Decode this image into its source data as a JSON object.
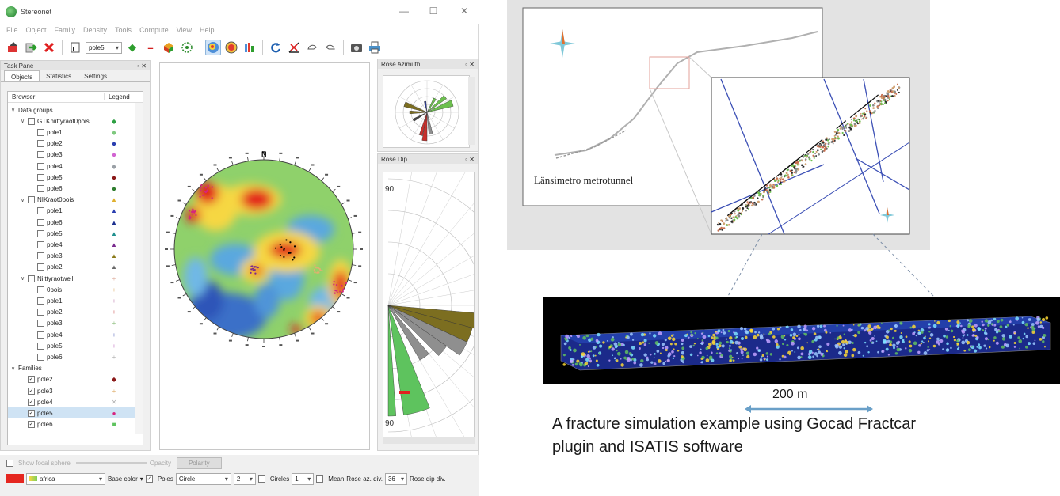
{
  "app": {
    "title": "Stereonet",
    "win_minimize": "—",
    "win_maximize": "☐",
    "win_close": "✕"
  },
  "menu": [
    "File",
    "Object",
    "Family",
    "Density",
    "Tools",
    "Compute",
    "View",
    "Help"
  ],
  "toolbar": {
    "selection": "pole5"
  },
  "task_pane": {
    "title": "Task Pane",
    "tabs": [
      "Objects",
      "Statistics",
      "Settings"
    ],
    "col_browser": "Browser",
    "col_legend": "Legend",
    "rows": [
      {
        "label": "Data groups",
        "level": 0,
        "twisty": "∨",
        "checkbox": false
      },
      {
        "label": "GTKniittyraot0pois",
        "level": 1,
        "twisty": "∨",
        "checkbox": true,
        "checked": false,
        "legend": "◆",
        "color": "#2ea043"
      },
      {
        "label": "pole1",
        "level": 2,
        "checkbox": true,
        "checked": false,
        "legend": "◆",
        "color": "#7fc97f"
      },
      {
        "label": "pole2",
        "level": 2,
        "checkbox": true,
        "checked": false,
        "legend": "◆",
        "color": "#2b3fb0"
      },
      {
        "label": "pole3",
        "level": 2,
        "checkbox": true,
        "checked": false,
        "legend": "◆",
        "color": "#d264d2"
      },
      {
        "label": "pole4",
        "level": 2,
        "checkbox": true,
        "checked": false,
        "legend": "◆",
        "color": "#9aa0a6"
      },
      {
        "label": "pole5",
        "level": 2,
        "checkbox": true,
        "checked": false,
        "legend": "◆",
        "color": "#8b1a1a"
      },
      {
        "label": "pole6",
        "level": 2,
        "checkbox": true,
        "checked": false,
        "legend": "◆",
        "color": "#2f7d2f"
      },
      {
        "label": "NIKraot0pois",
        "level": 1,
        "twisty": "∨",
        "checkbox": true,
        "checked": false,
        "legend": "▲",
        "color": "#e0b030"
      },
      {
        "label": "pole1",
        "level": 2,
        "checkbox": true,
        "checked": false,
        "legend": "▲",
        "color": "#2b3fb0"
      },
      {
        "label": "pole6",
        "level": 2,
        "checkbox": true,
        "checked": false,
        "legend": "▲",
        "color": "#1c2f8f"
      },
      {
        "label": "pole5",
        "level": 2,
        "checkbox": true,
        "checked": false,
        "legend": "▲",
        "color": "#20908f"
      },
      {
        "label": "pole4",
        "level": 2,
        "checkbox": true,
        "checked": false,
        "legend": "▲",
        "color": "#7a2a8f"
      },
      {
        "label": "pole3",
        "level": 2,
        "checkbox": true,
        "checked": false,
        "legend": "▲",
        "color": "#8a7a1a"
      },
      {
        "label": "pole2",
        "level": 2,
        "checkbox": true,
        "checked": false,
        "legend": "▲",
        "color": "#6a6a6a"
      },
      {
        "label": "Niittyraotwell",
        "level": 1,
        "twisty": "∨",
        "checkbox": true,
        "checked": false,
        "legend": "+",
        "color": "#e0b0a0"
      },
      {
        "label": "0pois",
        "level": 2,
        "checkbox": true,
        "checked": false,
        "legend": "+",
        "color": "#e0b070"
      },
      {
        "label": "pole1",
        "level": 2,
        "checkbox": true,
        "checked": false,
        "legend": "+",
        "color": "#c080b0"
      },
      {
        "label": "pole2",
        "level": 2,
        "checkbox": true,
        "checked": false,
        "legend": "+",
        "color": "#d06060"
      },
      {
        "label": "pole3",
        "level": 2,
        "checkbox": true,
        "checked": false,
        "legend": "+",
        "color": "#90c080"
      },
      {
        "label": "pole4",
        "level": 2,
        "checkbox": true,
        "checked": false,
        "legend": "+",
        "color": "#6070c0"
      },
      {
        "label": "pole5",
        "level": 2,
        "checkbox": true,
        "checked": false,
        "legend": "+",
        "color": "#c070c0"
      },
      {
        "label": "pole6",
        "level": 2,
        "checkbox": true,
        "checked": false,
        "legend": "+",
        "color": "#b0b0b0"
      },
      {
        "label": "Families",
        "level": 0,
        "twisty": "∨",
        "checkbox": false
      },
      {
        "label": "pole2",
        "level": 1,
        "checkbox": true,
        "checked": true,
        "legend": "◆",
        "color": "#8b1a1a"
      },
      {
        "label": "pole3",
        "level": 1,
        "checkbox": true,
        "checked": true,
        "legend": "+",
        "color": "#e0b070"
      },
      {
        "label": "pole4",
        "level": 1,
        "checkbox": true,
        "checked": true,
        "legend": "✕",
        "color": "#b0b0b0"
      },
      {
        "label": "pole5",
        "level": 1,
        "checkbox": true,
        "checked": true,
        "legend": "●",
        "color": "#d6247f",
        "selected": true
      },
      {
        "label": "pole6",
        "level": 1,
        "checkbox": true,
        "checked": true,
        "legend": "■",
        "color": "#5ec35e"
      }
    ]
  },
  "stereonet": {
    "north_label": "N"
  },
  "rose_azimuth": {
    "title": "Rose Azimuth"
  },
  "rose_dip": {
    "title": "Rose Dip",
    "label_top": "90",
    "label_bottom": "90"
  },
  "bottom": {
    "show_focal": "Show focal sphere",
    "opacity": "Opacity",
    "polarity": "Polarity",
    "color_hex": "#e5261f",
    "scheme": "africa",
    "base_color": "Base color",
    "poles": "Poles",
    "shape": "Circle",
    "size": "2",
    "circles": "Circles",
    "circles_n": "1",
    "mean": "Mean",
    "rose_az": "Rose az. div.",
    "rose_az_n": "36",
    "rose_dip": "Rose dip div."
  },
  "figure": {
    "tunnel_label": "Länsimetro metrotunnel",
    "scale_label": "200 m",
    "caption_line1": "A fracture simulation example using Gocad Fractcar",
    "caption_line2": "plugin and ISATIS software"
  },
  "colors": {
    "accent_select": "#cfe3f4",
    "hot": "#e31a1c",
    "warm": "#fdd835",
    "mid": "#7ccf5a",
    "cool": "#3d7fd6"
  }
}
